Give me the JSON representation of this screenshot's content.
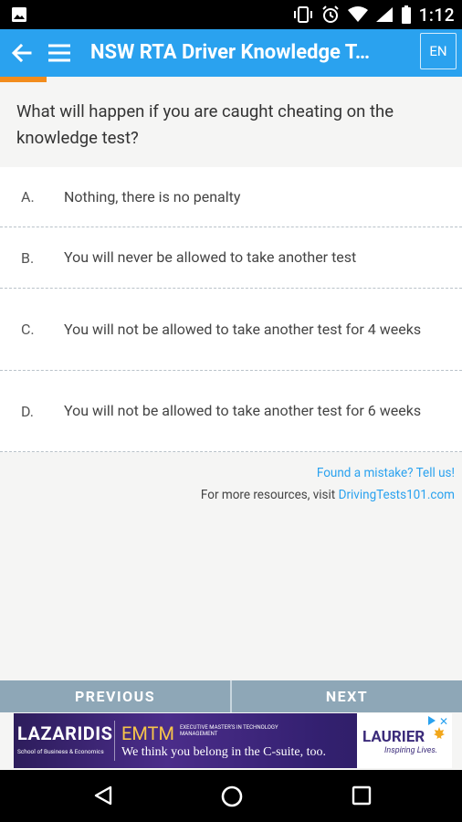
{
  "status_bar": {
    "time": "1:12"
  },
  "app_bar": {
    "title": "NSW RTA Driver Knowledge T…",
    "language": "EN",
    "accent_color": "#2aa2ef",
    "progress_color": "#f28c1d",
    "progress_fraction": 0.1
  },
  "question": {
    "text": "What will happen if you are caught cheating on the knowledge test?"
  },
  "answers": [
    {
      "letter": "A.",
      "text": "Nothing, there is no penalty"
    },
    {
      "letter": "B.",
      "text": "You will never be allowed to take another test"
    },
    {
      "letter": "C.",
      "text": "You will not be allowed to take another test for 4 weeks"
    },
    {
      "letter": "D.",
      "text": "You will not be allowed to take another test for 6 weeks"
    }
  ],
  "footer_links": {
    "mistake": "Found a mistake? Tell us!",
    "resources_prefix": "For more resources, visit",
    "resources_link": "DrivingTests101.com"
  },
  "navigation": {
    "previous": "PREVIOUS",
    "next": "NEXT"
  },
  "ad": {
    "left_brand": "LAZARIDIS",
    "left_sub": "School of Business & Economics",
    "program": "EMTM",
    "program_sub": "EXECUTIVE MASTER'S IN TECHNOLOGY MANAGEMENT",
    "tagline": "We think you belong in the C-suite, too.",
    "right_brand": "LAURIER",
    "right_sub": "Inspiring Lives."
  }
}
